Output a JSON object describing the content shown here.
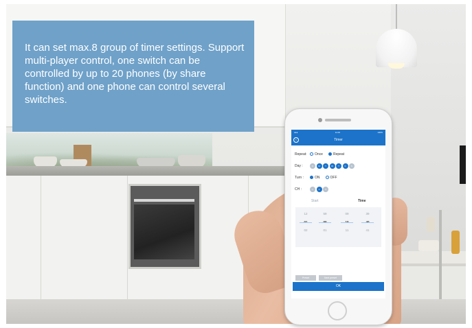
{
  "callout": {
    "text": "It can set max.8 group of timer settings. Support multi-player control, one switch can be controlled by up to 20 phones (by share function) and one phone can control several switches."
  },
  "app": {
    "status_left": "●●●",
    "status_time": "11:00",
    "status_right": "100%",
    "title": "Timer",
    "back_icon": "‹",
    "repeat": {
      "label": "Repeat:",
      "options": [
        "Once",
        "Repeat"
      ],
      "selected": "Repeat"
    },
    "day": {
      "label": "Day :",
      "days": [
        "S",
        "M",
        "T",
        "W",
        "T",
        "F",
        "S"
      ],
      "active": [
        false,
        true,
        true,
        true,
        true,
        true,
        false
      ]
    },
    "turn": {
      "label": "Turn :",
      "options": [
        "ON",
        "OFF"
      ],
      "selected": "ON"
    },
    "ch": {
      "label": "CH :",
      "channels": [
        "1",
        "2",
        "3"
      ],
      "active_index": 1
    },
    "tabs": {
      "left": "Start",
      "right": "Time",
      "active": "right"
    },
    "wheel": {
      "col1": [
        "12",
        "01",
        "02"
      ],
      "col2": [
        "59",
        "00",
        "01"
      ],
      "col3": [
        "09",
        "10",
        "11"
      ],
      "col4": [
        "39",
        "40",
        "41"
      ]
    },
    "presets": {
      "left": "Preset",
      "right": "Next preset"
    },
    "ok_label": "OK"
  },
  "colors": {
    "app_blue": "#1c73c9",
    "callout_blue": "#6fa1c9",
    "chip_off": "#b7c3cf"
  }
}
